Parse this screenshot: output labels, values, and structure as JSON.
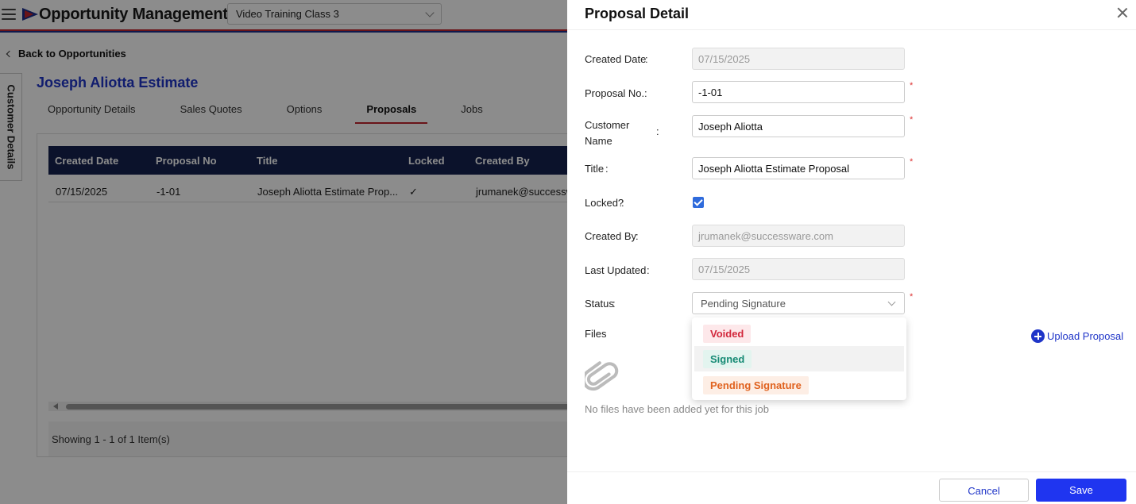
{
  "app": {
    "title": "Opportunity Management",
    "project_select": "Video Training Class 3",
    "back_label": "Back to Opportunities",
    "side_tab": "Customer Details",
    "opportunity_title": "Joseph Aliotta Estimate",
    "tabs": [
      "Opportunity Details",
      "Sales Quotes",
      "Options",
      "Proposals",
      "Jobs"
    ],
    "active_tab": "Proposals",
    "grid": {
      "columns": [
        "Created Date",
        "Proposal No",
        "Title",
        "Locked",
        "Created By"
      ],
      "rows": [
        [
          "07/15/2025",
          "-1-01",
          "Joseph Aliotta Estimate Prop...",
          "✓",
          "jrumanek@successw"
        ]
      ],
      "pager_text": "Showing 1 - 1 of 1 Item(s)"
    }
  },
  "drawer": {
    "title": "Proposal Detail",
    "fields": {
      "created_date": {
        "label": "Created Date",
        "value": "07/15/2025"
      },
      "proposal_no": {
        "label": "Proposal No.",
        "value": "-1-01"
      },
      "customer_name": {
        "label": "Customer Name",
        "value": "Joseph Aliotta"
      },
      "title": {
        "label": "Title",
        "value": "Joseph Aliotta Estimate Proposal"
      },
      "locked": {
        "label": "Locked?",
        "checked": true
      },
      "created_by": {
        "label": "Created By",
        "value": "jrumanek@successware.com"
      },
      "last_updated": {
        "label": "Last Updated",
        "value": "07/15/2025"
      },
      "status": {
        "label": "Status",
        "value": "Pending Signature"
      }
    },
    "required_marker": "*",
    "colon": ":",
    "status_options": [
      {
        "label": "Voided",
        "color": "#d2283c",
        "bg": "#fde8ea"
      },
      {
        "label": "Signed",
        "color": "#168a74",
        "bg": "#e3f4ef"
      },
      {
        "label": "Pending Signature",
        "color": "#e0621f",
        "bg": "#fdeee5"
      }
    ],
    "files_label": "Files",
    "upload_label": "Upload Proposal",
    "empty_files": "No files have been added yet for this job",
    "cancel_label": "Cancel",
    "save_label": "Save",
    "accent": "#1f35c8"
  }
}
